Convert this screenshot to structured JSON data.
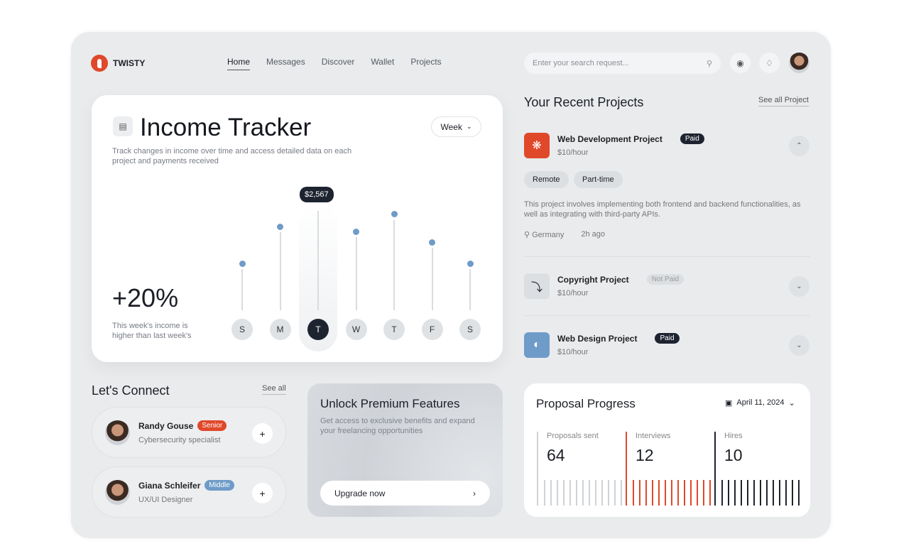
{
  "brand": {
    "name": "TWISTY",
    "color": "#e0482a"
  },
  "nav": {
    "items": [
      "Home",
      "Messages",
      "Discover",
      "Wallet",
      "Projects"
    ],
    "active": "Home"
  },
  "search": {
    "placeholder": "Enter your search request..."
  },
  "icons": {
    "search": "search-icon",
    "settings": "settings-icon",
    "notifications": "bell-icon"
  },
  "income": {
    "title": "Income Tracker",
    "description": "Track changes in income over time and access detailed data on each project and payments received",
    "period": "Week",
    "change": "+20%",
    "change_desc": "This week's income is higher than last week's",
    "tooltip": "$2,567"
  },
  "chart_data": {
    "type": "bar",
    "categories": [
      "S",
      "M",
      "T",
      "W",
      "T",
      "F",
      "S"
    ],
    "values": [
      1210,
      2160,
      2567,
      2030,
      2480,
      1760,
      1210
    ],
    "highlighted_index": 2,
    "highlight_label": "$2,567",
    "accent": "#6f9bc8"
  },
  "projects": {
    "title": "Your Recent Projects",
    "see_all": "See all Project",
    "items": [
      {
        "name": "Web Development Project",
        "rate": "$10/hour",
        "status": "Paid",
        "color": "#e0482a",
        "expanded": true,
        "tags": [
          "Remote",
          "Part-time"
        ],
        "description": "This project involves implementing both frontend and backend functionalities, as well as integrating with third-party APIs.",
        "location": "Germany",
        "time": "2h ago"
      },
      {
        "name": "Copyright Project",
        "rate": "$10/hour",
        "status": "Not Paid",
        "color": "#dcdfe2",
        "expanded": false
      },
      {
        "name": "Web Design Project",
        "rate": "$10/hour",
        "status": "Paid",
        "color": "#6f9bc8",
        "expanded": false
      }
    ]
  },
  "connect": {
    "title": "Let's Connect",
    "see_all": "See all",
    "people": [
      {
        "name": "Randy Gouse",
        "level": "Senior",
        "level_color": "#e0482a",
        "role": "Cybersecurity specialist"
      },
      {
        "name": "Giana Schleifer",
        "level": "Middle",
        "level_color": "#6f9bc8",
        "role": "UX/UI Designer"
      }
    ]
  },
  "premium": {
    "title": "Unlock Premium Features",
    "description": "Get access to exclusive benefits and expand your freelancing opportunities",
    "button": "Upgrade now"
  },
  "proposal": {
    "title": "Proposal Progress",
    "date": "April 11, 2024",
    "stats": [
      {
        "label": "Proposals sent",
        "value": "64",
        "color": "#cfd2d6"
      },
      {
        "label": "Interviews",
        "value": "12",
        "color": "#e0482a"
      },
      {
        "label": "Hires",
        "value": "10",
        "color": "#1d2430"
      }
    ]
  }
}
